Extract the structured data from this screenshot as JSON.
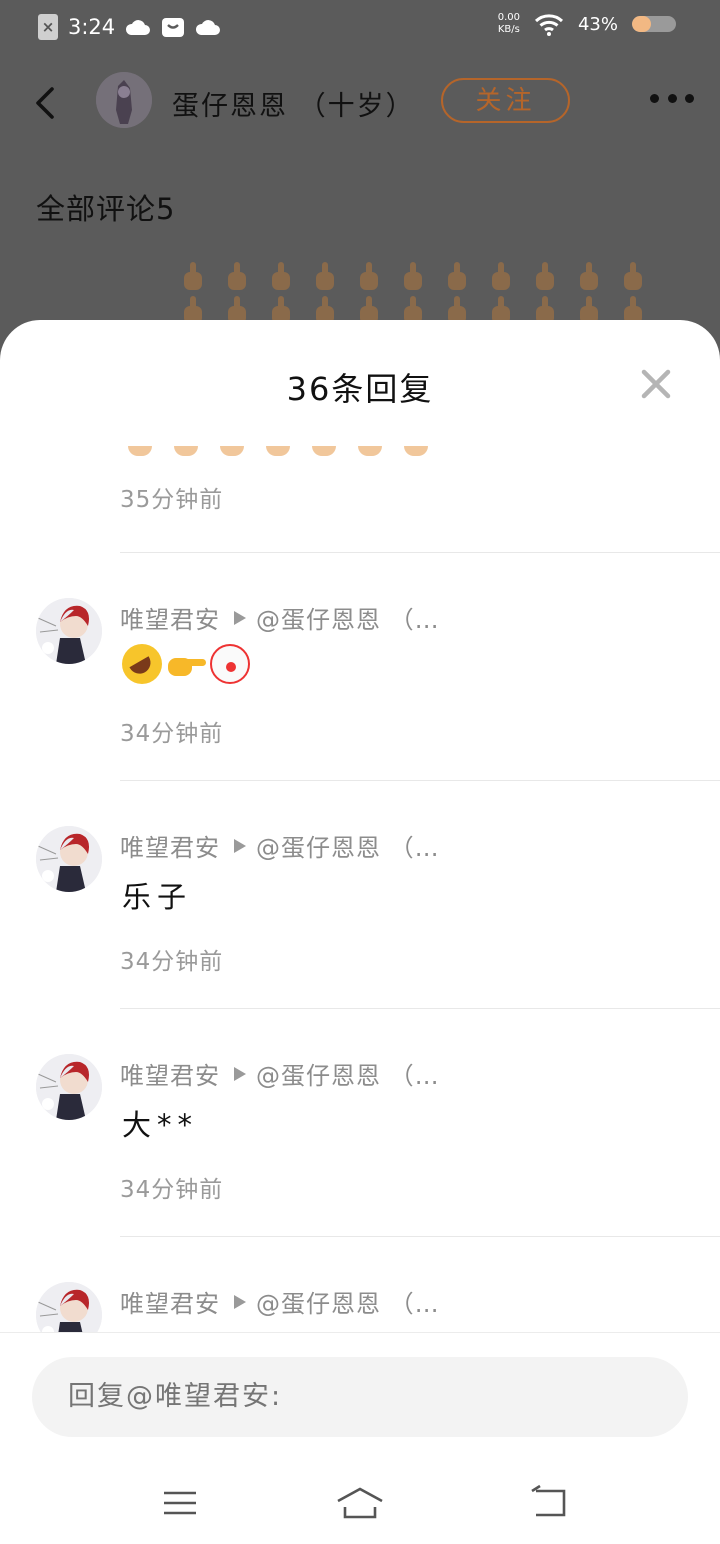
{
  "status_bar": {
    "time": "3:24",
    "net_speed_value": "0.00",
    "net_speed_unit": "KB/s",
    "battery": "43%",
    "battery_level": 0.43,
    "battery_color": "#f2b883"
  },
  "header": {
    "author_name": "蛋仔恩恩 （十岁）",
    "follow_label": "关注",
    "follow_color": "#b5652a"
  },
  "comments": {
    "count_label": "全部评论5"
  },
  "sheet": {
    "title": "36条回复",
    "partial_time": "35分钟前",
    "replies": [
      {
        "user": "唯望君安",
        "target": "@蛋仔恩恩 （…",
        "text": "",
        "emojis": [
          "rolling-laughing-emoji",
          "pointing-right-emoji",
          "clown-face-emoji"
        ],
        "time": "34分钟前"
      },
      {
        "user": "唯望君安",
        "target": "@蛋仔恩恩 （…",
        "text": "乐子",
        "time": "34分钟前"
      },
      {
        "user": "唯望君安",
        "target": "@蛋仔恩恩 （…",
        "text": "大**",
        "time": "34分钟前"
      },
      {
        "user": "唯望君安",
        "target": "@蛋仔恩恩 （…",
        "text": "",
        "time": ""
      }
    ]
  },
  "input": {
    "placeholder": "回复@唯望君安:"
  },
  "navbar": {
    "icons": [
      "menu-icon",
      "home-icon",
      "back-return-icon"
    ]
  }
}
